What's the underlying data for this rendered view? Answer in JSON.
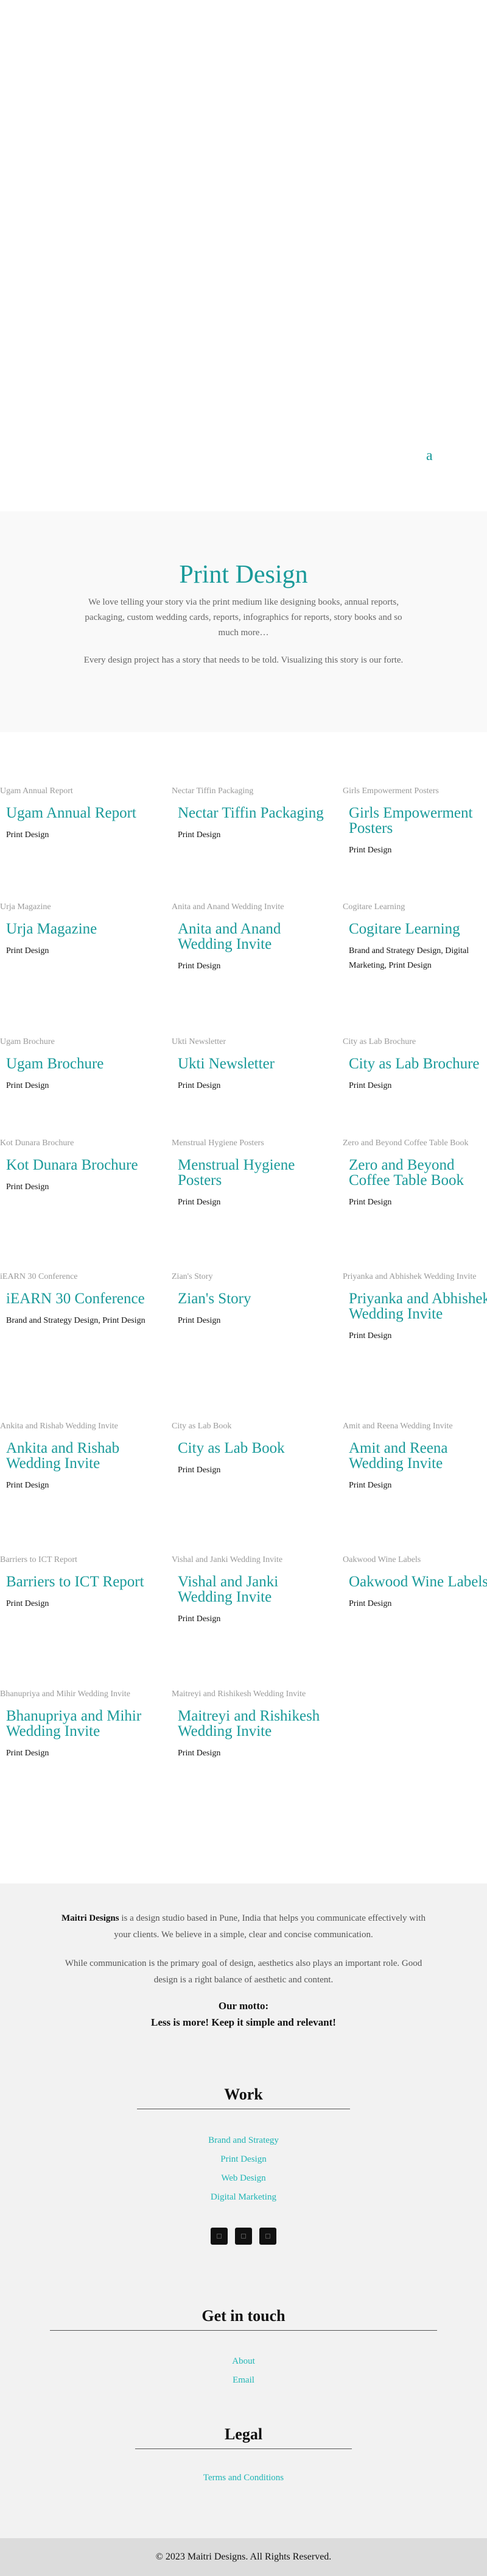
{
  "hero": {
    "link_label": "a"
  },
  "intro": {
    "title": "Print Design",
    "paragraph1": "We love telling your story via the print medium like designing books, annual reports, packaging, custom wedding cards, reports, infographics for reports, story books and so much more…",
    "paragraph2": "Every design project has a story that needs to be told. Visualizing this story is our forte."
  },
  "projects": [
    {
      "alt": "Ugam Annual Report",
      "title": "Ugam Annual Report",
      "category": "Print Design"
    },
    {
      "alt": "Nectar Tiffin Packaging",
      "title": "Nectar Tiffin Packaging",
      "category": "Print Design"
    },
    {
      "alt": "Girls Empowerment Posters",
      "title": "Girls Empowerment Posters",
      "category": "Print Design"
    },
    {
      "alt": "Urja Magazine",
      "title": "Urja Magazine",
      "category": "Print Design"
    },
    {
      "alt": "Anita and Anand Wedding Invite",
      "title": "Anita and Anand Wedding Invite",
      "category": "Print Design"
    },
    {
      "alt": "Cogitare Learning",
      "title": "Cogitare Learning",
      "category": "Brand and Strategy Design, Digital Marketing, Print Design"
    },
    {
      "alt": "Ugam Brochure",
      "title": "Ugam Brochure",
      "category": "Print Design"
    },
    {
      "alt": "Ukti Newsletter",
      "title": "Ukti Newsletter",
      "category": "Print Design"
    },
    {
      "alt": "City as Lab Brochure",
      "title": "City as Lab Brochure",
      "category": "Print Design"
    },
    {
      "alt": "Kot Dunara Brochure",
      "title": "Kot Dunara Brochure",
      "category": "Print Design"
    },
    {
      "alt": "Menstrual Hygiene Posters",
      "title": "Menstrual Hygiene Posters",
      "category": "Print Design"
    },
    {
      "alt": "Zero and Beyond Coffee Table Book",
      "title": "Zero and Beyond Coffee Table Book",
      "category": "Print Design"
    },
    {
      "alt": "iEARN 30 Conference",
      "title": "iEARN 30 Conference",
      "category": "Brand and Strategy Design, Print Design"
    },
    {
      "alt": "Zian's Story",
      "title": "Zian's Story",
      "category": "Print Design"
    },
    {
      "alt": "Priyanka and Abhishek Wedding Invite",
      "title": "Priyanka and Abhishek Wedding Invite",
      "category": "Print Design"
    },
    {
      "alt": "Ankita and Rishab Wedding Invite",
      "title": "Ankita and Rishab Wedding Invite",
      "category": "Print Design"
    },
    {
      "alt": "City as Lab Book",
      "title": "City as Lab Book",
      "category": "Print Design"
    },
    {
      "alt": "Amit and Reena Wedding Invite",
      "title": "Amit and Reena Wedding Invite",
      "category": "Print Design"
    },
    {
      "alt": "Barriers to ICT Report",
      "title": "Barriers to ICT Report",
      "category": "Print Design"
    },
    {
      "alt": "Vishal and Janki Wedding Invite",
      "title": "Vishal and Janki Wedding Invite",
      "category": "Print Design"
    },
    {
      "alt": "Oakwood Wine Labels",
      "title": "Oakwood Wine Labels",
      "category": "Print Design"
    },
    {
      "alt": "Bhanupriya and Mihir Wedding Invite",
      "title": "Bhanupriya and Mihir Wedding Invite",
      "category": "Print Design"
    },
    {
      "alt": "Maitreyi and Rishikesh Wedding Invite",
      "title": "Maitreyi and Rishikesh Wedding Invite",
      "category": "Print Design"
    }
  ],
  "footer": {
    "brand": "Maitri Designs",
    "about1": " is a design studio based in Pune, India that helps you communicate effectively with your clients. We believe in a simple, clear and concise communication.",
    "about2": "While communication is the primary goal of design, aesthetics also plays an important role. Good design is a right balance of aesthetic and content.",
    "motto_label": "Our motto:",
    "motto_text": "Less is more!  Keep it simple and relevant!",
    "work": {
      "heading": "Work",
      "links": [
        "Brand and Strategy",
        "Print Design",
        "Web Design",
        "Digital Marketing"
      ]
    },
    "social_icons": [
      "social-icon-1",
      "social-icon-2",
      "social-icon-3"
    ],
    "contact": {
      "heading": "Get in touch",
      "links": [
        "About",
        "Email"
      ]
    },
    "legal": {
      "heading": "Legal",
      "links": [
        "Terms and Conditions"
      ]
    },
    "copyright": "© 2023 Maitri Designs. All Rights Reserved."
  }
}
